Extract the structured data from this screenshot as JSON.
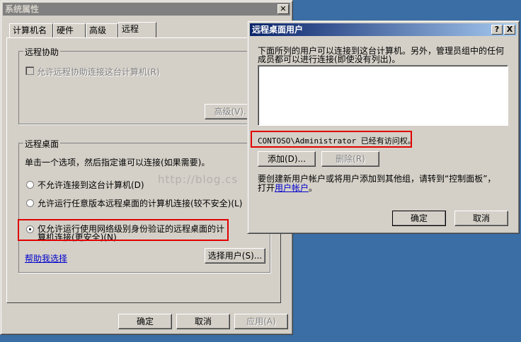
{
  "sysprops": {
    "title": "系统属性",
    "tabs": [
      "计算机名",
      "硬件",
      "高级",
      "远程"
    ],
    "remote_assist": {
      "group_title": "远程协助",
      "checkbox_label": "允许远程协助连接这台计算机(R)",
      "advanced_button": "高级(V)..."
    },
    "remote_desktop": {
      "group_title": "远程桌面",
      "instruction": "单击一个选项，然后指定谁可以连接(如果需要)。",
      "options": [
        "不允许连接到这台计算机(D)",
        "允许运行任意版本远程桌面的计算机连接(较不安全)(L)",
        "仅允许运行使用网络级别身份验证的远程桌面的计",
        "算机连接(更安全)(N)"
      ],
      "help_link": "帮助我选择",
      "select_users_button": "选择用户(S)..."
    },
    "buttons": {
      "ok": "确定",
      "cancel": "取消",
      "apply": "应用(A)"
    }
  },
  "rdusers": {
    "title": "远程桌面用户",
    "help_btn": "?",
    "close_btn": "X",
    "description_line1": "下面所列的用户可以连接到这台计算机。另外，管理员组中的任何",
    "description_line2": "成员都可以进行连接(即使没有列出)。",
    "access_note": "CONTOSO\\Administrator 已经有访问权。",
    "add_button": "添加(D)...",
    "remove_button": "删除(R)",
    "hint_line1": "要创建新用户帐户或将用户添加到其他组，请转到“控制面板”，",
    "hint_prefix": "打开",
    "hint_link": "用户帐户",
    "hint_suffix": "。",
    "ok": "确定",
    "cancel": "取消"
  },
  "watermark": "http://blog.cs"
}
